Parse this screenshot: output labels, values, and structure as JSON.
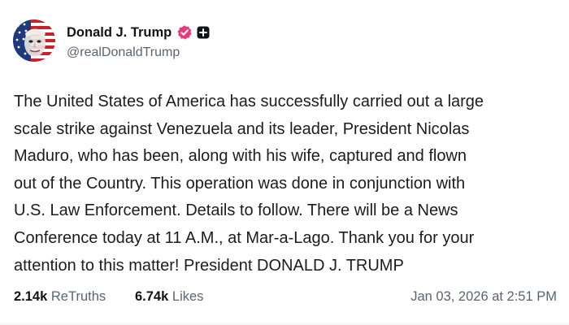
{
  "author": {
    "display_name": "Donald J. Trump",
    "handle": "@realDonaldTrump",
    "verified_badge_color": "#e8397a",
    "avatar_icon": "flag-face-avatar",
    "badges": [
      "verified-check-icon",
      "plus-square-icon"
    ]
  },
  "post": {
    "lines": [
      "The United States of America has successfully carried out a large",
      "scale strike against Venezuela and its leader, President Nicolas",
      "Maduro, who has been, along with his wife, captured and flown",
      "out of the Country. This operation was done in conjunction with",
      "U.S. Law Enforcement. Details to follow. There will be a News",
      "Conference today at 11 A.M., at Mar-a-Lago. Thank you for your",
      "attention to this matter! President DONALD J. TRUMP"
    ]
  },
  "stats": {
    "retruths_count": "2.14k",
    "retruths_label": "ReTruths",
    "likes_count": "6.74k",
    "likes_label": "Likes"
  },
  "timestamp": "Jan 03, 2026 at 2:51 PM"
}
